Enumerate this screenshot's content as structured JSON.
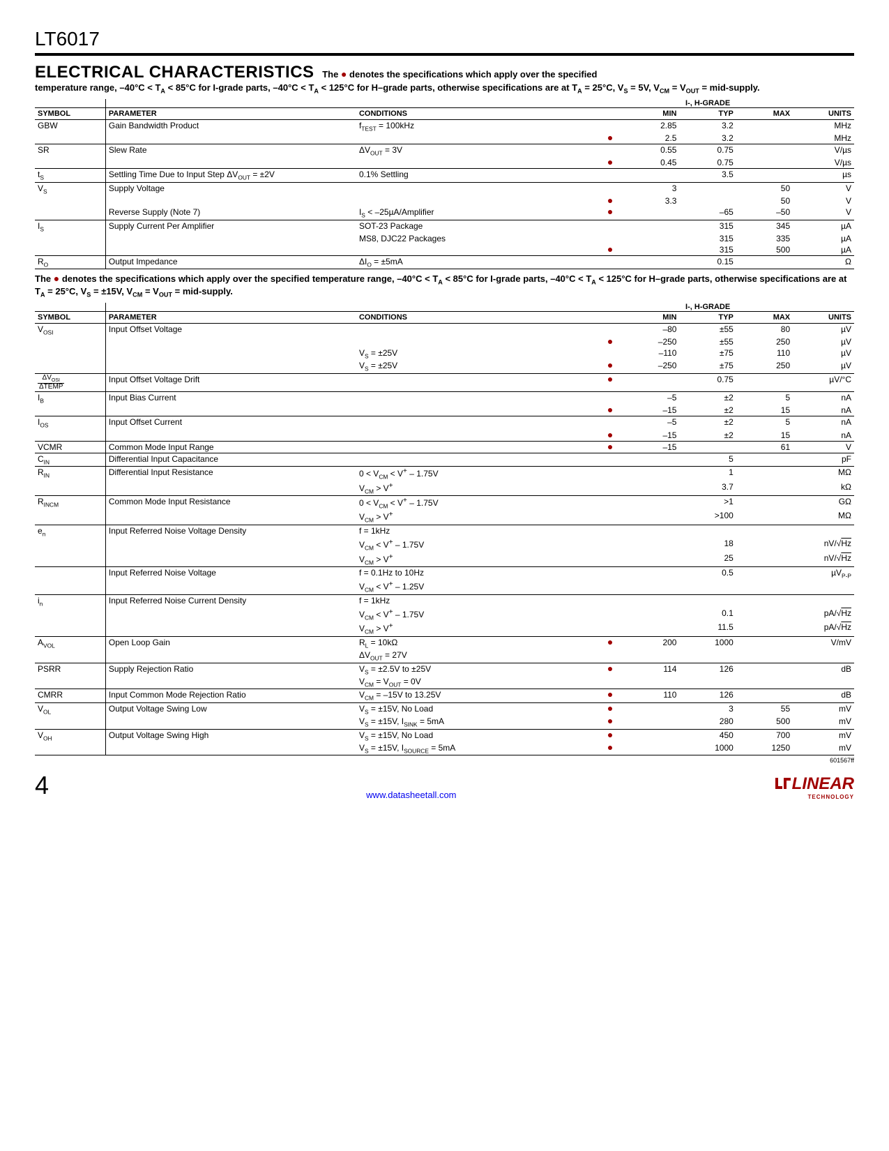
{
  "partNumber": "LT6017",
  "sectionTitle": "ELECTRICAL CHARACTERISTICS",
  "note1_a": "The ● denotes the specifications which apply over the specified",
  "note1_b": "temperature range, –40°C < T_A < 85°C for I-grade parts, –40°C < T_A < 125°C for H–grade parts, otherwise specifications are at T_A = 25°C, V_S = 5V, V_CM = V_OUT = mid-supply.",
  "midNote": "The ● denotes the specifications which apply over the specified temperature range, –40°C < T_A < 85°C for I-grade parts, –40°C < T_A < 125°C for H–grade parts, otherwise specifications are at T_A = 25°C, V_S = ±15V, V_CM = V_OUT = mid-supply.",
  "headers": {
    "symbol": "SYMBOL",
    "parameter": "PARAMETER",
    "conditions": "CONDITIONS",
    "gradeLabel": "I-, H-GRADE",
    "min": "MIN",
    "typ": "TYP",
    "max": "MAX",
    "units": "UNITS"
  },
  "table1": [
    {
      "sym": "GBW",
      "param": "Gain Bandwidth Product",
      "rows": [
        {
          "cond": "f_TEST = 100kHz",
          "bullet": false,
          "min": "2.85",
          "typ": "3.2",
          "max": "",
          "units": "MHz"
        },
        {
          "cond": "",
          "bullet": true,
          "min": "2.5",
          "typ": "3.2",
          "max": "",
          "units": "MHz"
        }
      ]
    },
    {
      "sym": "SR",
      "param": "Slew Rate",
      "rows": [
        {
          "cond": "ΔV_OUT = 3V",
          "bullet": false,
          "min": "0.55",
          "typ": "0.75",
          "max": "",
          "units": "V/µs"
        },
        {
          "cond": "",
          "bullet": true,
          "min": "0.45",
          "typ": "0.75",
          "max": "",
          "units": "V/µs"
        }
      ]
    },
    {
      "sym": "t_S",
      "param": "Settling Time Due to Input Step ΔV_OUT = ±2V",
      "rows": [
        {
          "cond": "0.1% Settling",
          "bullet": false,
          "min": "",
          "typ": "3.5",
          "max": "",
          "units": "µs"
        }
      ]
    },
    {
      "sym": "V_S",
      "param": "Supply Voltage",
      "rows": [
        {
          "cond": "",
          "bullet": false,
          "min": "3",
          "typ": "",
          "max": "50",
          "units": "V"
        },
        {
          "cond": "",
          "bullet": true,
          "min": "3.3",
          "typ": "",
          "max": "50",
          "units": "V"
        },
        {
          "param2": "Reverse Supply (Note 7)",
          "cond": "I_S < –25µA/Amplifier",
          "bullet": true,
          "min": "",
          "typ": "–65",
          "max": "–50",
          "units": "V"
        }
      ]
    },
    {
      "sym": "I_S",
      "param": "Supply Current Per Amplifier",
      "rows": [
        {
          "cond": "SOT-23 Package",
          "bullet": false,
          "min": "",
          "typ": "315",
          "max": "345",
          "units": "µA"
        },
        {
          "cond": "MS8, DJC22 Packages",
          "bullet": false,
          "min": "",
          "typ": "315",
          "max": "335",
          "units": "µA"
        },
        {
          "cond": "",
          "bullet": true,
          "min": "",
          "typ": "315",
          "max": "500",
          "units": "µA"
        }
      ]
    },
    {
      "sym": "R_O",
      "param": "Output Impedance",
      "rows": [
        {
          "cond": "ΔI_O = ±5mA",
          "bullet": false,
          "min": "",
          "typ": "0.15",
          "max": "",
          "units": "Ω"
        }
      ]
    }
  ],
  "table2": [
    {
      "sym": "V_OSI",
      "param": "Input Offset Voltage",
      "rows": [
        {
          "cond": "",
          "bullet": false,
          "min": "–80",
          "typ": "±55",
          "max": "80",
          "units": "µV"
        },
        {
          "cond": "",
          "bullet": true,
          "min": "–250",
          "typ": "±55",
          "max": "250",
          "units": "µV"
        },
        {
          "cond": "V_S = ±25V",
          "bullet": false,
          "min": "–110",
          "typ": "±75",
          "max": "110",
          "units": "µV"
        },
        {
          "cond": "V_S = ±25V",
          "bullet": true,
          "min": "–250",
          "typ": "±75",
          "max": "250",
          "units": "µV"
        }
      ]
    },
    {
      "sym": "ΔV_OSI/ΔTEMP",
      "symFrac": true,
      "param": "Input Offset Voltage Drift",
      "rows": [
        {
          "cond": "",
          "bullet": true,
          "min": "",
          "typ": "0.75",
          "max": "",
          "units": "µV/°C"
        }
      ]
    },
    {
      "sym": "I_B",
      "param": "Input Bias Current",
      "rows": [
        {
          "cond": "",
          "bullet": false,
          "min": "–5",
          "typ": "±2",
          "max": "5",
          "units": "nA"
        },
        {
          "cond": "",
          "bullet": true,
          "min": "–15",
          "typ": "±2",
          "max": "15",
          "units": "nA"
        }
      ]
    },
    {
      "sym": "I_OS",
      "param": "Input Offset Current",
      "rows": [
        {
          "cond": "",
          "bullet": false,
          "min": "–5",
          "typ": "±2",
          "max": "5",
          "units": "nA"
        },
        {
          "cond": "",
          "bullet": true,
          "min": "–15",
          "typ": "±2",
          "max": "15",
          "units": "nA"
        }
      ]
    },
    {
      "sym": "VCMR",
      "param": "Common Mode Input Range",
      "rows": [
        {
          "cond": "",
          "bullet": true,
          "min": "–15",
          "typ": "",
          "max": "61",
          "units": "V"
        }
      ]
    },
    {
      "sym": "C_IN",
      "param": "Differential Input Capacitance",
      "rows": [
        {
          "cond": "",
          "bullet": false,
          "min": "",
          "typ": "5",
          "max": "",
          "units": "pF"
        }
      ]
    },
    {
      "sym": "R_IN",
      "param": "Differential Input Resistance",
      "rows": [
        {
          "cond": "0 < V_CM < V⁺ – 1.75V",
          "bullet": false,
          "min": "",
          "typ": "1",
          "max": "",
          "units": "MΩ"
        },
        {
          "cond": "V_CM > V⁺",
          "bullet": false,
          "min": "",
          "typ": "3.7",
          "max": "",
          "units": "kΩ"
        }
      ]
    },
    {
      "sym": "R_INCM",
      "param": "Common Mode Input Resistance",
      "rows": [
        {
          "cond": "0 < V_CM < V⁺ – 1.75V",
          "bullet": false,
          "min": "",
          "typ": ">1",
          "max": "",
          "units": "GΩ"
        },
        {
          "cond": "V_CM > V⁺",
          "bullet": false,
          "min": "",
          "typ": ">100",
          "max": "",
          "units": "MΩ"
        }
      ]
    },
    {
      "sym": "e_n",
      "param": "Input Referred Noise Voltage Density",
      "rows": [
        {
          "cond": "f = 1kHz",
          "bullet": false,
          "min": "",
          "typ": "",
          "max": "",
          "units": ""
        },
        {
          "cond": "V_CM < V⁺ – 1.75V",
          "bullet": false,
          "min": "",
          "typ": "18",
          "max": "",
          "units": "nV/√Hz"
        },
        {
          "cond": "V_CM > V⁺",
          "bullet": false,
          "min": "",
          "typ": "25",
          "max": "",
          "units": "nV/√Hz"
        }
      ]
    },
    {
      "sym": "",
      "param": "Input Referred Noise Voltage",
      "rows": [
        {
          "cond": "f = 0.1Hz to 10Hz",
          "bullet": false,
          "min": "",
          "typ": "0.5",
          "max": "",
          "units": "µV_P-P"
        },
        {
          "cond": "V_CM < V⁺ – 1.25V",
          "bullet": false,
          "min": "",
          "typ": "",
          "max": "",
          "units": ""
        }
      ]
    },
    {
      "sym": "i_n",
      "param": "Input Referred Noise Current Density",
      "rows": [
        {
          "cond": "f = 1kHz",
          "bullet": false,
          "min": "",
          "typ": "",
          "max": "",
          "units": ""
        },
        {
          "cond": "V_CM < V⁺ – 1.75V",
          "bullet": false,
          "min": "",
          "typ": "0.1",
          "max": "",
          "units": "pA/√Hz"
        },
        {
          "cond": "V_CM > V⁺",
          "bullet": false,
          "min": "",
          "typ": "11.5",
          "max": "",
          "units": "pA/√Hz"
        }
      ]
    },
    {
      "sym": "A_VOL",
      "param": "Open Loop Gain",
      "rows": [
        {
          "cond": "R_L = 10kΩ",
          "bullet": true,
          "min": "200",
          "typ": "1000",
          "max": "",
          "units": "V/mV"
        },
        {
          "cond": "ΔV_OUT = 27V",
          "bullet": false,
          "min": "",
          "typ": "",
          "max": "",
          "units": ""
        }
      ]
    },
    {
      "sym": "PSRR",
      "param": "Supply Rejection Ratio",
      "rows": [
        {
          "cond": "V_S = ±2.5V to ±25V",
          "bullet": true,
          "min": "114",
          "typ": "126",
          "max": "",
          "units": "dB"
        },
        {
          "cond": "V_CM = V_OUT = 0V",
          "bullet": false,
          "min": "",
          "typ": "",
          "max": "",
          "units": ""
        }
      ]
    },
    {
      "sym": "CMRR",
      "param": "Input Common Mode Rejection Ratio",
      "rows": [
        {
          "cond": "V_CM = –15V to 13.25V",
          "bullet": true,
          "min": "110",
          "typ": "126",
          "max": "",
          "units": "dB"
        }
      ]
    },
    {
      "sym": "V_OL",
      "param": "Output Voltage Swing Low",
      "rows": [
        {
          "cond": "V_S = ±15V, No Load",
          "bullet": true,
          "min": "",
          "typ": "3",
          "max": "55",
          "units": "mV"
        },
        {
          "cond": "V_S = ±15V, I_SINK = 5mA",
          "bullet": true,
          "min": "",
          "typ": "280",
          "max": "500",
          "units": "mV"
        }
      ]
    },
    {
      "sym": "V_OH",
      "param": "Output Voltage Swing High",
      "rows": [
        {
          "cond": "V_S = ±15V, No Load",
          "bullet": true,
          "min": "",
          "typ": "450",
          "max": "700",
          "units": "mV"
        },
        {
          "cond": "V_S = ±15V, I_SOURCE = 5mA",
          "bullet": true,
          "min": "",
          "typ": "1000",
          "max": "1250",
          "units": "mV"
        }
      ]
    }
  ],
  "docId": "601567ff",
  "pageNumber": "4",
  "footerLink": "www.datasheetall.com",
  "logoMain": "LINEAR",
  "logoSub": "TECHNOLOGY"
}
